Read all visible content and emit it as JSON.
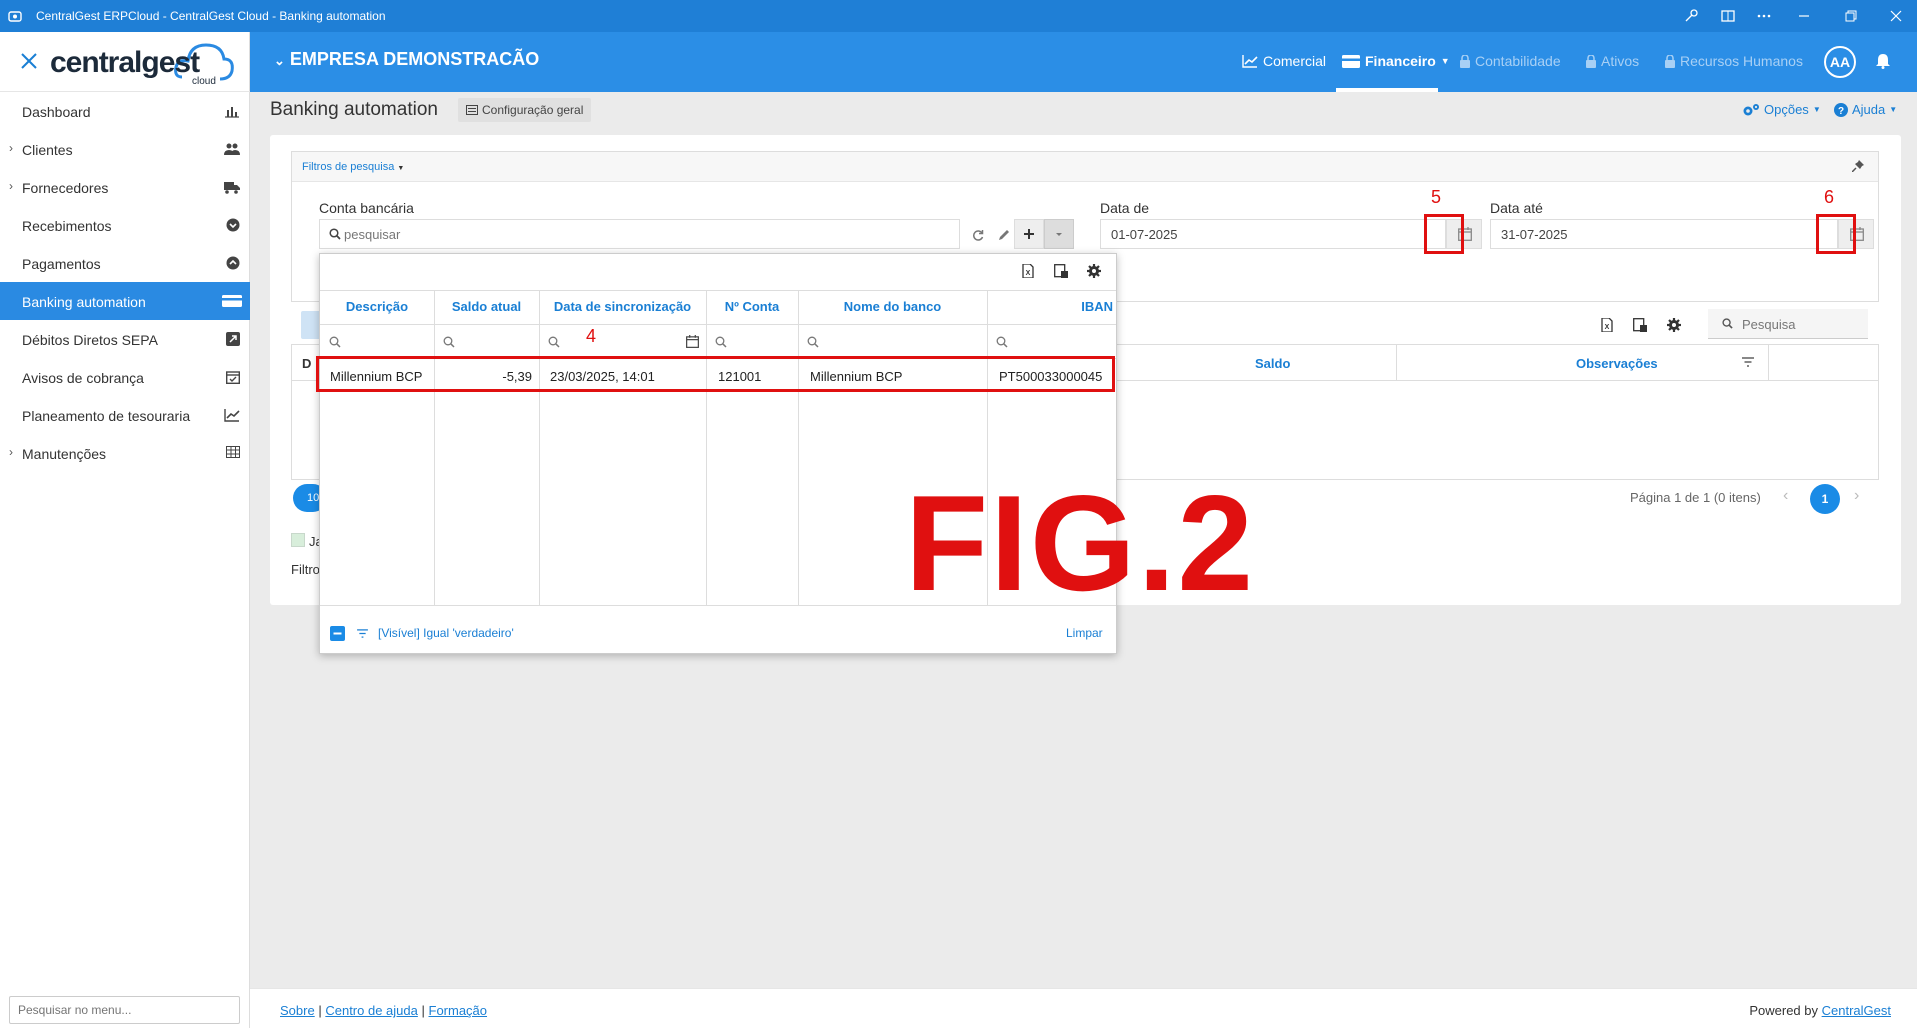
{
  "window": {
    "title": "CentralGest ERPCloud - CentralGest Cloud - Banking automation"
  },
  "brand": {
    "name": "centralgest",
    "sub": "cloud",
    "accent": "#2b8ee6"
  },
  "sidebar": {
    "items": [
      {
        "label": "Dashboard",
        "icon": "bar-chart-icon",
        "has_children": false
      },
      {
        "label": "Clientes",
        "icon": "users-icon",
        "has_children": true
      },
      {
        "label": "Fornecedores",
        "icon": "truck-icon",
        "has_children": true
      },
      {
        "label": "Recebimentos",
        "icon": "circle-down-icon",
        "has_children": false
      },
      {
        "label": "Pagamentos",
        "icon": "circle-up-icon",
        "has_children": false
      },
      {
        "label": "Banking automation",
        "icon": "card-icon",
        "has_children": false,
        "active": true
      },
      {
        "label": "Débitos Diretos SEPA",
        "icon": "external-icon",
        "has_children": false
      },
      {
        "label": "Avisos de cobrança",
        "icon": "calendar-check-icon",
        "has_children": false
      },
      {
        "label": "Planeamento de tesouraria",
        "icon": "line-chart-icon",
        "has_children": false
      },
      {
        "label": "Manutenções",
        "icon": "table-icon",
        "has_children": true
      }
    ],
    "search_placeholder": "Pesquisar no menu..."
  },
  "header": {
    "company": "EMPRESA DEMONSTRACÃO",
    "nav": [
      {
        "label": "Comercial",
        "icon": "line-chart-icon",
        "enabled": true
      },
      {
        "label": "Financeiro",
        "icon": "card-icon",
        "enabled": true,
        "active": true
      },
      {
        "label": "Contabilidade",
        "icon": "lock-icon",
        "enabled": false
      },
      {
        "label": "Ativos",
        "icon": "lock-icon",
        "enabled": false
      },
      {
        "label": "Recursos Humanos",
        "icon": "lock-icon",
        "enabled": false
      }
    ],
    "avatar": "AA"
  },
  "page": {
    "title": "Banking automation",
    "config_label": "Configuração geral",
    "options_label": "Opções",
    "help_label": "Ajuda"
  },
  "filters": {
    "header": "Filtros de pesquisa",
    "account_label": "Conta bancária",
    "account_placeholder": "pesquisar",
    "date_from_label": "Data de",
    "date_from": "01-07-2025",
    "date_to_label": "Data até",
    "date_to": "31-07-2025"
  },
  "grid": {
    "search_placeholder": "Pesquisa",
    "columns": [
      "Saldo",
      "Observações"
    ],
    "first_col_letter": "D",
    "pager_text": "Página 1 de 1 (0 itens)",
    "current_page": "1",
    "page_size_fragment": "10",
    "legend_fragment": "Ja",
    "filter_fragment": "Filtro"
  },
  "dropdown": {
    "columns": [
      "Descrição",
      "Saldo atual",
      "Data de sincronização",
      "Nº Conta",
      "Nome do banco",
      "IBAN"
    ],
    "rows": [
      {
        "descricao": "Millennium BCP",
        "saldo": "-5,39",
        "data": "23/03/2025, 14:01",
        "conta": "121001",
        "banco": "Millennium BCP",
        "iban": "PT500033000045"
      }
    ],
    "filter_text": "[Visível] Igual 'verdadeiro'",
    "clear_label": "Limpar"
  },
  "annotations": {
    "n4": "4",
    "n5": "5",
    "n6": "6",
    "fig": "FIG.2",
    "color": "#e01010"
  },
  "footer": {
    "links": [
      "Sobre",
      "Centro de ajuda",
      "Formação"
    ],
    "sep": "|",
    "powered": "Powered by",
    "powered_link": "CentralGest"
  }
}
